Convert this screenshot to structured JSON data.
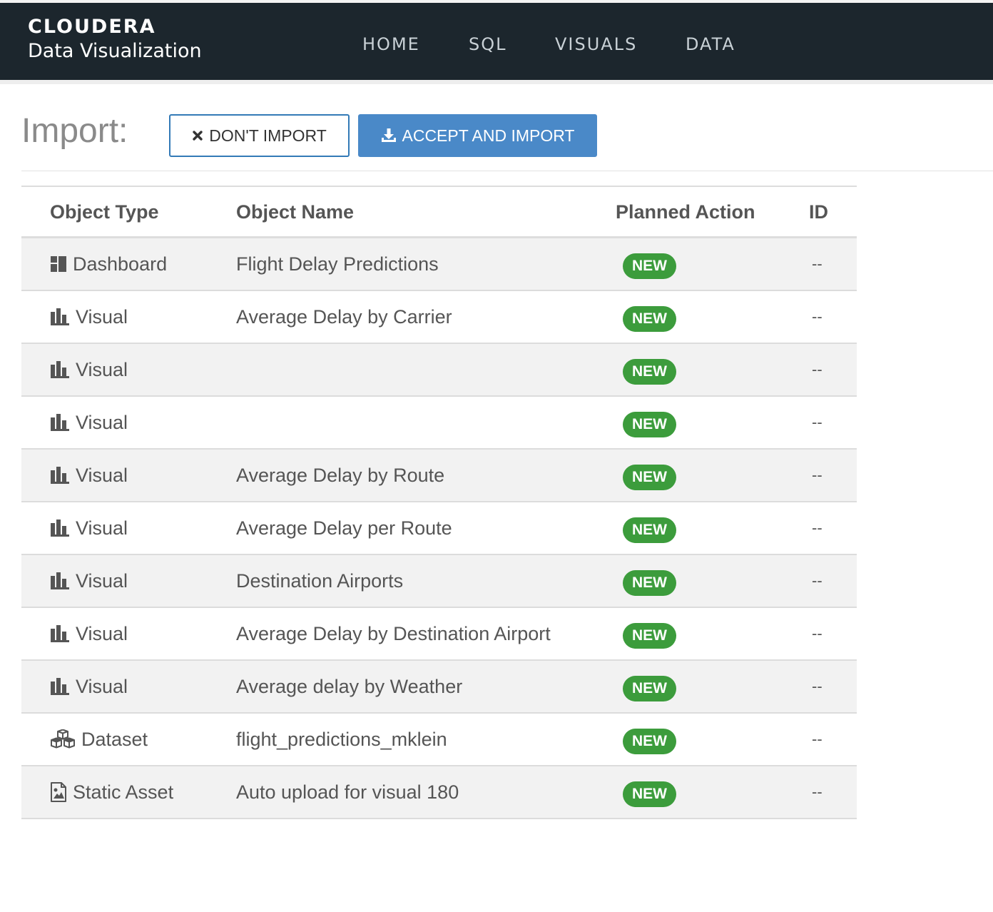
{
  "header": {
    "logo": "CLOUDERA",
    "product": "Data Visualization",
    "nav": [
      "HOME",
      "SQL",
      "VISUALS",
      "DATA"
    ]
  },
  "import": {
    "title": "Import:",
    "dont_import_label": "DON'T IMPORT",
    "accept_label": "ACCEPT AND IMPORT"
  },
  "table": {
    "columns": [
      "Object Type",
      "Object Name",
      "Planned Action",
      "ID"
    ],
    "rows": [
      {
        "type": "Dashboard",
        "icon": "dashboard-icon",
        "name": "Flight Delay Predictions",
        "action": "NEW",
        "id": "--"
      },
      {
        "type": "Visual",
        "icon": "bar-chart-icon",
        "name": "Average Delay by Carrier",
        "action": "NEW",
        "id": "--"
      },
      {
        "type": "Visual",
        "icon": "bar-chart-icon",
        "name": "",
        "action": "NEW",
        "id": "--"
      },
      {
        "type": "Visual",
        "icon": "bar-chart-icon",
        "name": "",
        "action": "NEW",
        "id": "--"
      },
      {
        "type": "Visual",
        "icon": "bar-chart-icon",
        "name": "Average Delay by Route",
        "action": "NEW",
        "id": "--"
      },
      {
        "type": "Visual",
        "icon": "bar-chart-icon",
        "name": "Average Delay per Route",
        "action": "NEW",
        "id": "--"
      },
      {
        "type": "Visual",
        "icon": "bar-chart-icon",
        "name": "Destination Airports",
        "action": "NEW",
        "id": "--"
      },
      {
        "type": "Visual",
        "icon": "bar-chart-icon",
        "name": "Average Delay by Destination Airport",
        "action": "NEW",
        "id": "--"
      },
      {
        "type": "Visual",
        "icon": "bar-chart-icon",
        "name": "Average delay by Weather",
        "action": "NEW",
        "id": "--"
      },
      {
        "type": "Dataset",
        "icon": "dataset-cubes-icon",
        "name": "flight_predictions_mklein",
        "action": "NEW",
        "id": "--"
      },
      {
        "type": "Static Asset",
        "icon": "image-file-icon",
        "name": "Auto upload for visual 180",
        "action": "NEW",
        "id": "--"
      }
    ]
  },
  "colors": {
    "header_bg": "#1c262d",
    "accent_blue": "#4a89c8",
    "badge_green": "#3c9c3c",
    "row_alt": "#f2f2f2"
  }
}
